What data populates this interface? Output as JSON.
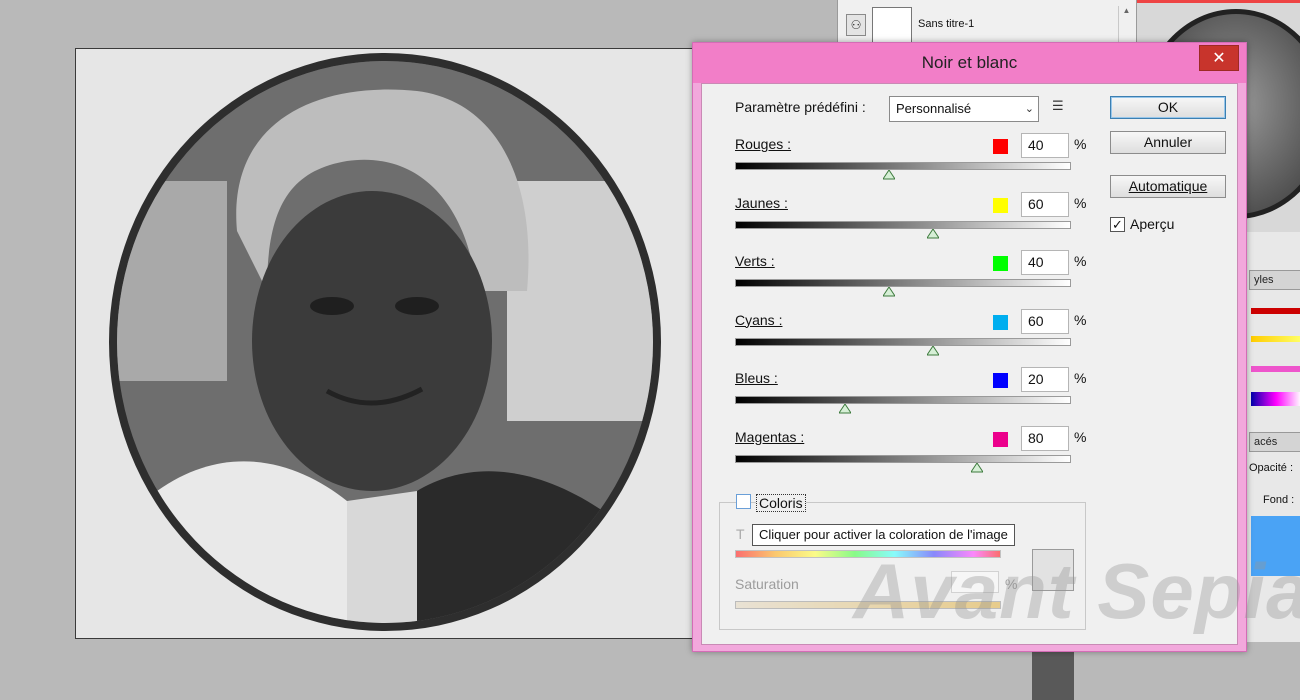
{
  "layers_panel": {
    "layer_name": "Sans titre-1",
    "panel_tab_styles": "yles",
    "panel_tab_traces": "acés",
    "opacity_label": "Opacité :",
    "fond_label": "Fond :"
  },
  "dialog": {
    "title": "Noir et blanc",
    "close_glyph": "✕",
    "preset_label": "Paramètre prédéfini :",
    "preset_value": "Personnalisé",
    "buttons": {
      "ok": "OK",
      "cancel": "Annuler",
      "auto": "Automatique"
    },
    "preview": {
      "label": "Aperçu",
      "checked": true
    },
    "sliders": [
      {
        "label": "Rouges :",
        "value": "40",
        "percent": 40,
        "color": "#ff0000"
      },
      {
        "label": "Jaunes :",
        "value": "60",
        "percent": 60,
        "color": "#ffff00"
      },
      {
        "label": "Verts :",
        "value": "40",
        "percent": 40,
        "color": "#00ff00"
      },
      {
        "label": "Cyans :",
        "value": "60",
        "percent": 60,
        "color": "#00aeef"
      },
      {
        "label": "Bleus :",
        "value": "20",
        "percent": 20,
        "color": "#0000ff"
      },
      {
        "label": "Magentas :",
        "value": "80",
        "percent": 80,
        "color": "#ec008c"
      }
    ],
    "pct_sign": "%",
    "coloris_label": "Coloris",
    "coloris_checked": false,
    "tooltip": "Cliquer pour activer la coloration de l'image",
    "tint_partial": "T",
    "saturation_label": "Saturation",
    "saturation_pct": "%"
  },
  "watermark": "Avant Sepia"
}
